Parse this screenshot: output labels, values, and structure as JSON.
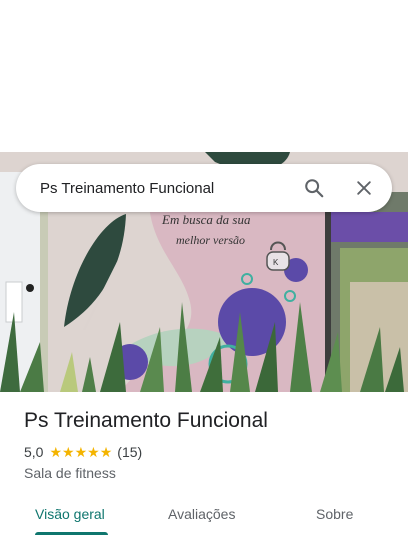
{
  "search": {
    "query": "Ps Treinamento Funcional"
  },
  "icons": {
    "search": "search-icon",
    "close": "close-icon",
    "star": "star-icon"
  },
  "photo": {
    "wall_text_line1": "Em busca da sua",
    "wall_text_line2": "melhor versão",
    "kettlebell_label": "K"
  },
  "place": {
    "title": "Ps Treinamento Funcional",
    "rating": "5,0",
    "stars": 5,
    "review_count": "(15)",
    "category": "Sala de fitness"
  },
  "tabs": [
    {
      "label": "Visão geral",
      "active": true
    },
    {
      "label": "Avaliações",
      "active": false
    },
    {
      "label": "Sobre",
      "active": false
    }
  ],
  "colors": {
    "accent": "#0f766e",
    "star": "#f4b400",
    "text": "#202124",
    "secondary_text": "#5f6368"
  }
}
